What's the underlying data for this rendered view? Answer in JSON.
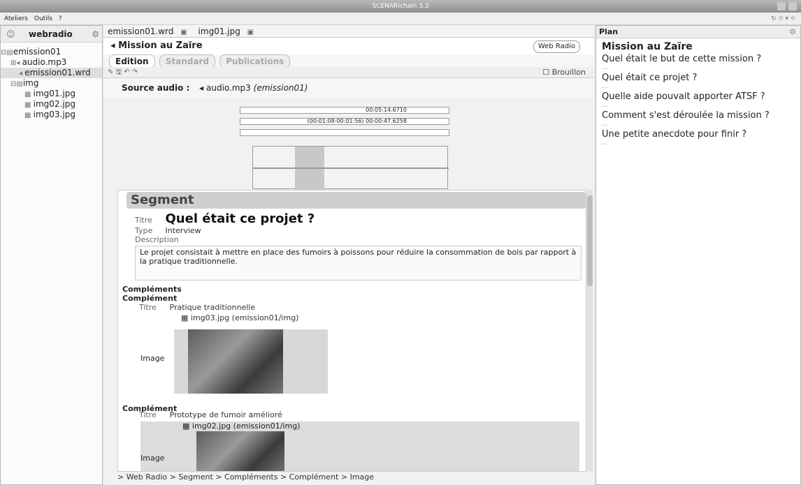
{
  "window": {
    "title": "SCENARIchain 3.3"
  },
  "menu": [
    "Ateliers",
    "Outils",
    "?"
  ],
  "left": {
    "title": "webradio",
    "tree": [
      "emission01",
      "audio.mp3",
      "emission01.wrd",
      "img",
      "img01.jpg",
      "img02.jpg",
      "img03.jpg"
    ]
  },
  "center": {
    "tabs": [
      "emission01.wrd",
      "img01.jpg"
    ],
    "doc_title": "Mission au Zaïre",
    "model_badge": "Web Radio",
    "modes": [
      "Edition",
      "Standard",
      "Publications"
    ],
    "draft_label": "Brouillon",
    "source_label": "Source audio :",
    "source_file": "audio.mp3",
    "source_path": "(emission01)",
    "player": {
      "total_time": "00:05:14.6710",
      "segment_time": "(00:01:08-00:01:56) 00:00:47.6258"
    },
    "segment": {
      "heading": "Segment",
      "titre_label": "Titre",
      "titre_value": "Quel était ce projet ?",
      "type_label": "Type",
      "type_value": "Interview",
      "description_label": "Description",
      "description_text": "Le projet consistait à mettre en place des fumoirs à poissons pour réduire la consommation de bois par rapport à la pratique traditionnelle.",
      "complements_label": "Compléments",
      "complement_label": "Complément",
      "complement1_title": "Pratique traditionnelle",
      "complement1_file": "img03.jpg",
      "complement1_path": "(emission01/img)",
      "image_label": "Image",
      "complement2_title": "Prototype de fumoir amélioré",
      "complement2_file": "img02.jpg",
      "complement2_path": "(emission01/img)"
    },
    "breadcrumb": "> Web Radio > Segment > Compléments > Complément > Image"
  },
  "right": {
    "title": "Plan",
    "plan_title": "Mission au Zaïre",
    "items": [
      "Quel était le but de cette mission ?",
      "Quel était ce projet ?",
      "Quelle aide pouvait apporter ATSF ?",
      "Comment s'est déroulée la mission ?",
      "Une petite anecdote pour finir ?"
    ],
    "dots": "..."
  }
}
